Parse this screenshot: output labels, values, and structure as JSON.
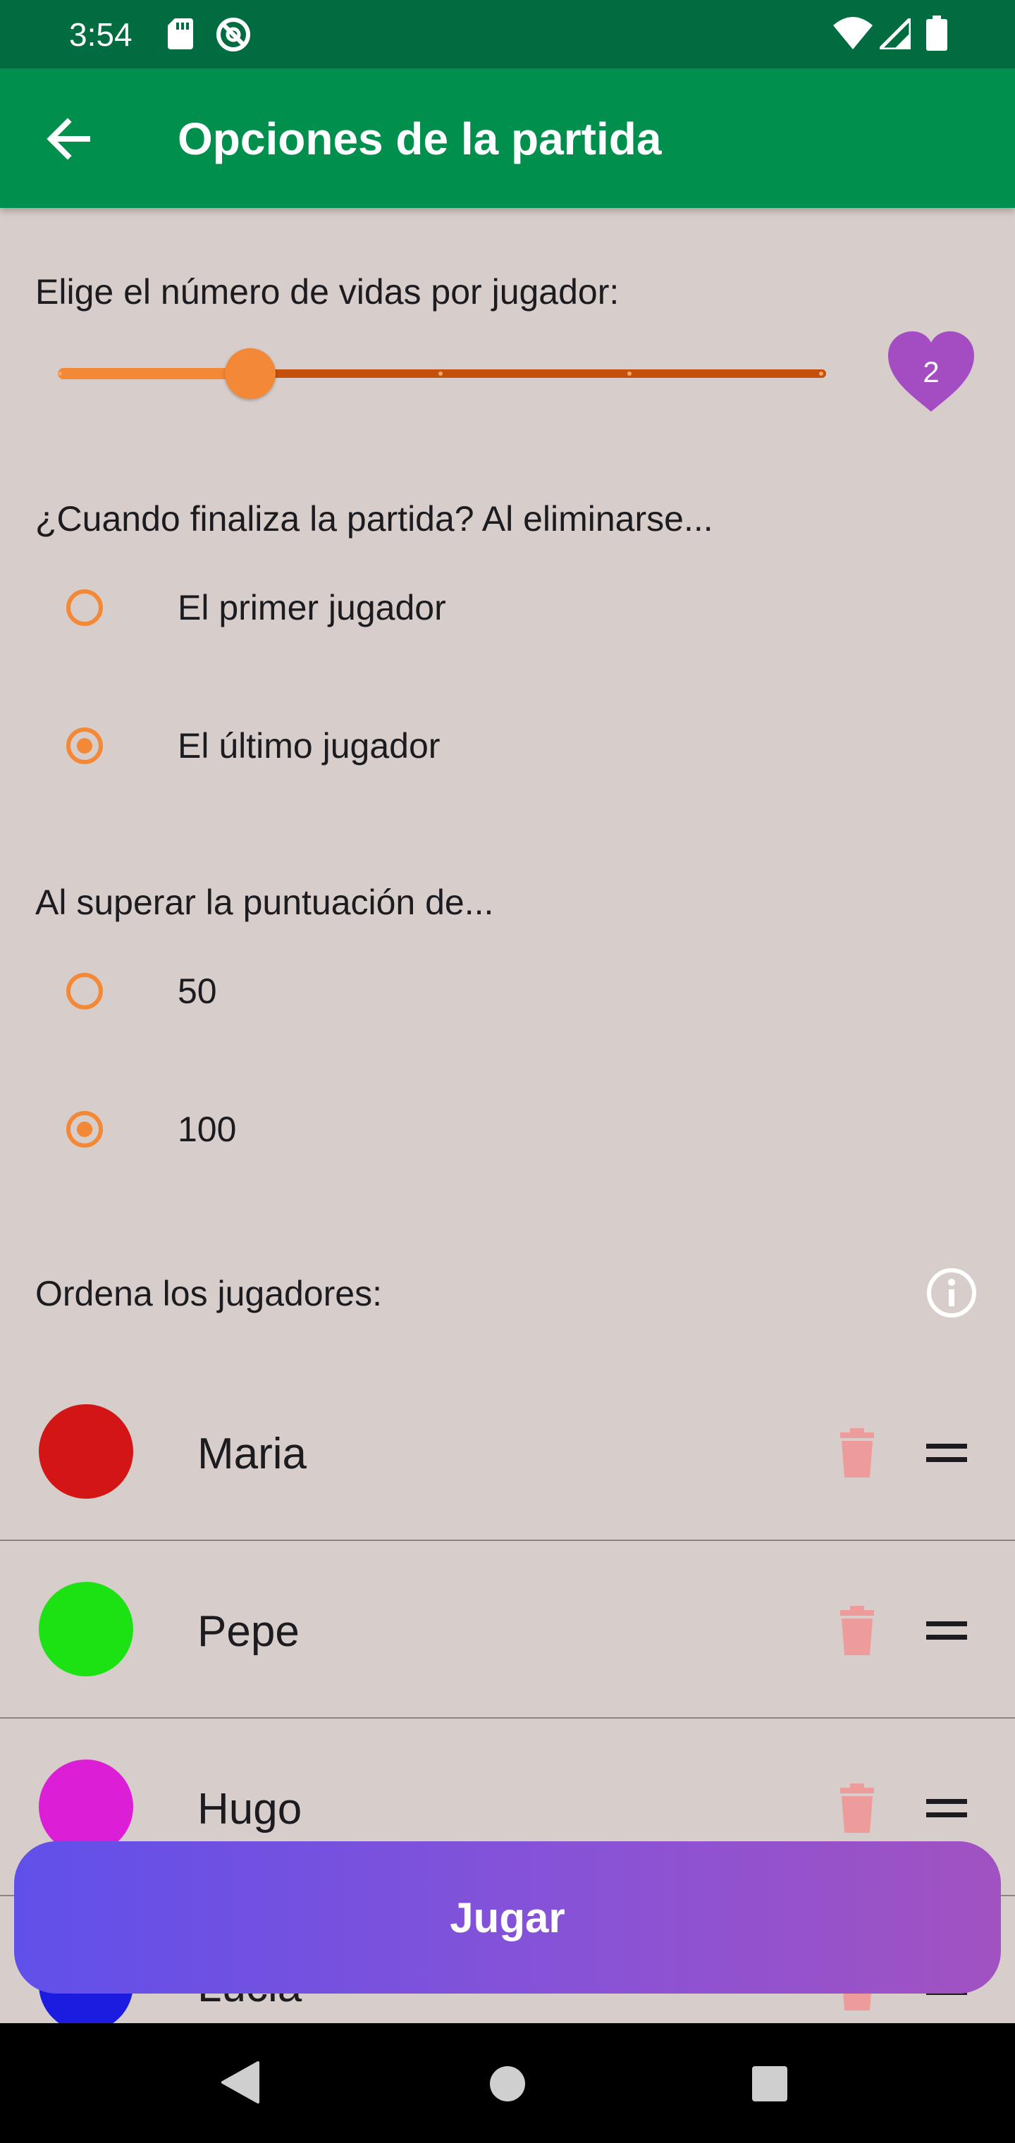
{
  "status_bar": {
    "time": "3:54",
    "icons": [
      "sd-card-icon",
      "at-sign-icon",
      "wifi-icon",
      "cell-signal-icon",
      "battery-icon"
    ]
  },
  "app_bar": {
    "back_icon": "arrow-left-icon",
    "title": "Opciones de la partida"
  },
  "lives": {
    "label": "Elige el número de vidas por jugador:",
    "slider_min": 1,
    "slider_max": 5,
    "value": 2,
    "value_display": "2",
    "badge_icon": "heart-icon"
  },
  "end_condition": {
    "label": "¿Cuando finaliza la partida? Al eliminarse...",
    "options": [
      {
        "label": "El primer jugador",
        "selected": false
      },
      {
        "label": "El último jugador",
        "selected": true
      }
    ]
  },
  "score_limit": {
    "label": "Al superar la puntuación de...",
    "options": [
      {
        "label": "50",
        "selected": false
      },
      {
        "label": "100",
        "selected": true
      }
    ]
  },
  "players": {
    "label": "Ordena los jugadores:",
    "info_icon": "info-icon",
    "list": [
      {
        "name": "Maria",
        "color": "#d41515"
      },
      {
        "name": "Pepe",
        "color": "#1ce214"
      },
      {
        "name": "Hugo",
        "color": "#dc1ed6"
      },
      {
        "name": "Lucia",
        "color": "#1c1ce0"
      }
    ]
  },
  "colors": {
    "status_bar": "#006c40",
    "app_bar": "#008f4c",
    "background": "#d7cdca",
    "accent": "#f38836",
    "heart": "#a44dc3",
    "trash": "#ee9b9b"
  },
  "play_button": {
    "label": "Jugar"
  },
  "nav_bar": {
    "icons": [
      "nav-back-icon",
      "nav-home-icon",
      "nav-recents-icon"
    ]
  }
}
